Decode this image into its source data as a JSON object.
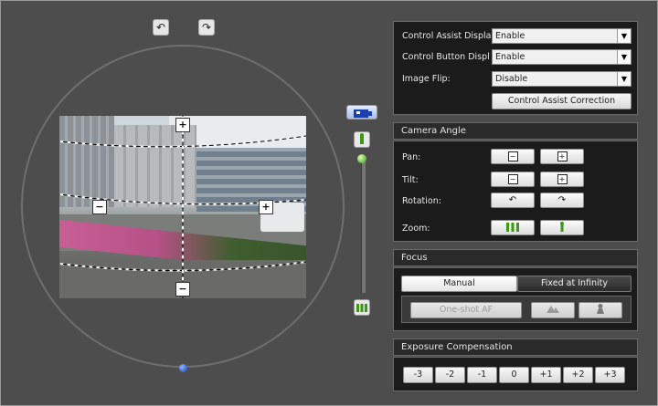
{
  "rotate": {
    "left": "↶",
    "right": "↷"
  },
  "image_controls": {
    "plus": "+",
    "minus": "−",
    "left_minus": "−",
    "right_plus": "+"
  },
  "zoom_slider": {
    "level": 0.0
  },
  "settings": {
    "control_assist_display": {
      "label": "Control Assist Display",
      "value": "Enable"
    },
    "control_button_display": {
      "label": "Control Button Display",
      "value": "Enable"
    },
    "image_flip": {
      "label": "Image Flip:",
      "value": "Disable"
    },
    "correction_button": "Control Assist Correction"
  },
  "camera_angle": {
    "title": "Camera Angle",
    "pan": "Pan:",
    "tilt": "Tilt:",
    "rotation": "Rotation:",
    "zoom": "Zoom:"
  },
  "focus": {
    "title": "Focus",
    "manual": "Manual",
    "fixed": "Fixed at Infinity",
    "one_shot": "One-shot AF"
  },
  "exposure": {
    "title": "Exposure Compensation",
    "values": [
      "-3",
      "-2",
      "-1",
      "0",
      "+1",
      "+2",
      "+3"
    ]
  },
  "colors": {
    "accent_green": "#3b9a12",
    "accent_blue": "#1b3fb0"
  }
}
